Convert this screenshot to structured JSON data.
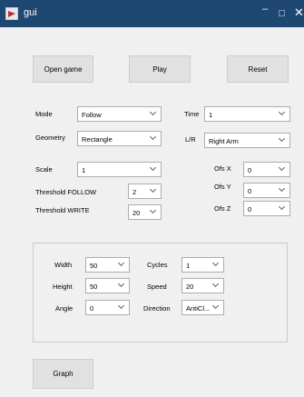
{
  "window": {
    "title": "gui",
    "minimize_glyph": "–",
    "close_glyph": "✕"
  },
  "buttons": {
    "open_game": "Open game",
    "play": "Play",
    "reset": "Reset",
    "graph": "Graph"
  },
  "labels": {
    "mode": "Mode",
    "geometry": "Geometry",
    "time": "Time",
    "lr": "L/R",
    "scale": "Scale",
    "threshold_follow": "Threshold FOLLOW",
    "threshold_write": "Threshold WRITE",
    "ofs_x": "Ofs X",
    "ofs_y": "Ofs Y",
    "ofs_z": "Ofs Z",
    "width": "Width",
    "height": "Height",
    "angle": "Angle",
    "cycles": "Cycles",
    "speed": "Speed",
    "direction": "Direction"
  },
  "dropdowns": {
    "mode": "Follow",
    "geometry": "Rectangle",
    "time": "1",
    "lr": "Right Arm",
    "scale": "1",
    "threshold_follow": "2",
    "threshold_write": "20",
    "ofs_x": "0",
    "ofs_y": "0",
    "ofs_z": "0",
    "width": "50",
    "height": "50",
    "angle": "0",
    "cycles": "1",
    "speed": "20",
    "direction": "AntiCl..."
  },
  "icons": {
    "app": "matlab-figure-icon",
    "dropdown": "chevron-down-icon"
  }
}
